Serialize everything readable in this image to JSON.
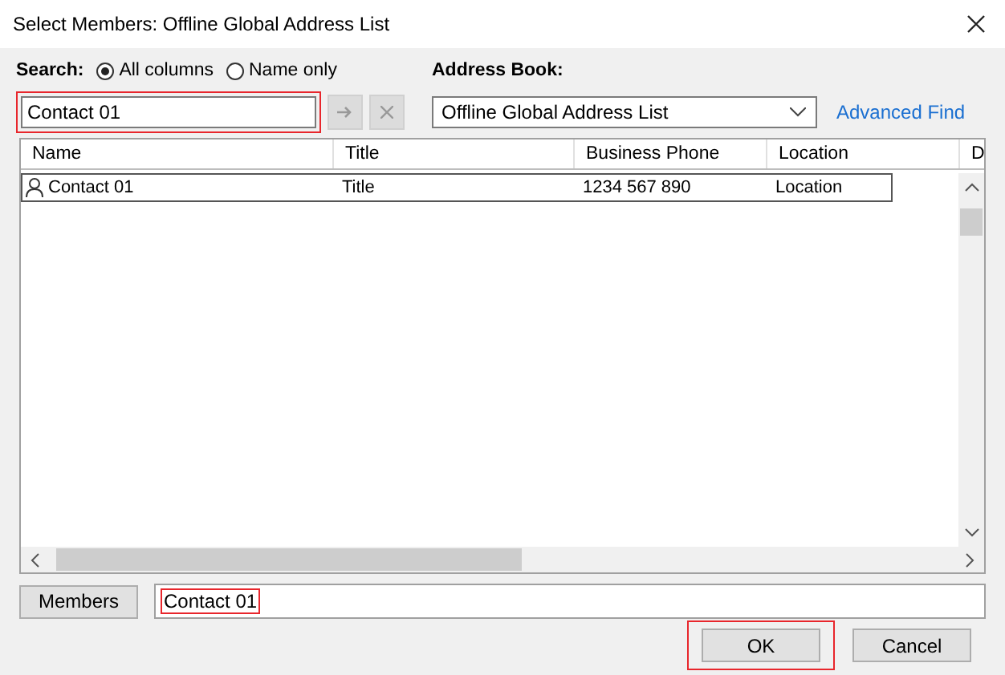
{
  "window": {
    "title": "Select Members: Offline Global Address List"
  },
  "search": {
    "label": "Search:",
    "options": [
      {
        "label": "All columns",
        "selected": true
      },
      {
        "label": "Name only",
        "selected": false
      }
    ],
    "value": "Contact 01",
    "highlighted": true
  },
  "address_book": {
    "label": "Address Book:",
    "value": "Offline Global Address List"
  },
  "advanced_find": "Advanced Find",
  "table": {
    "columns": [
      "Name",
      "Title",
      "Business Phone",
      "Location",
      "D"
    ],
    "rows": [
      {
        "cells": [
          "Contact 01",
          "Title",
          "1234 567 890",
          "Location"
        ],
        "highlighted": true
      }
    ]
  },
  "members": {
    "button": "Members",
    "value": "Contact 01",
    "highlighted": true
  },
  "buttons": [
    {
      "label": "OK",
      "highlighted": true
    },
    {
      "label": "Cancel",
      "highlighted": false
    }
  ]
}
